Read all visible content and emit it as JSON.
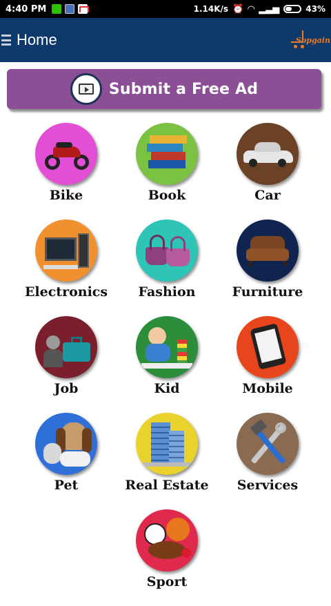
{
  "status_bar": {
    "time": "4:40 PM",
    "speed": "1.14K/s",
    "battery": "43%",
    "icons": [
      "wechat-icon",
      "app-icon",
      "gmail-icon",
      "alarm-icon",
      "wifi-icon",
      "signal-icon",
      "battery-icon"
    ]
  },
  "app_bar": {
    "title": "Home",
    "logo_text": "Sopgain",
    "accent": "#0e3a6b",
    "logo_color": "#f07a22"
  },
  "submit_ad": {
    "label": "Submit a Free Ad",
    "color": "#8a4f95"
  },
  "categories": [
    {
      "label": "Bike",
      "color": "#e24fd6",
      "icon": "motorbike-icon"
    },
    {
      "label": "Book",
      "color": "#7cc242",
      "icon": "books-icon"
    },
    {
      "label": "Car",
      "color": "#6b4226",
      "icon": "car-icon"
    },
    {
      "label": "Electronics",
      "color": "#f0902e",
      "icon": "computer-icon"
    },
    {
      "label": "Fashion",
      "color": "#2ec4b6",
      "icon": "handbag-icon"
    },
    {
      "label": "Furniture",
      "color": "#0f2550",
      "icon": "armchair-icon"
    },
    {
      "label": "Job",
      "color": "#7a1f2b",
      "icon": "briefcase-icon"
    },
    {
      "label": "Kid",
      "color": "#2c8d3a",
      "icon": "baby-icon"
    },
    {
      "label": "Mobile",
      "color": "#e8451c",
      "icon": "smartphone-icon"
    },
    {
      "label": "Pet",
      "color": "#2e6fd8",
      "icon": "dog-cat-icon"
    },
    {
      "label": "Real Estate",
      "color": "#e9d22c",
      "icon": "building-icon"
    },
    {
      "label": "Services",
      "color": "#8a6a50",
      "icon": "tools-icon"
    },
    {
      "label": "Sport",
      "color": "#e02a4d",
      "icon": "balls-icon"
    }
  ]
}
